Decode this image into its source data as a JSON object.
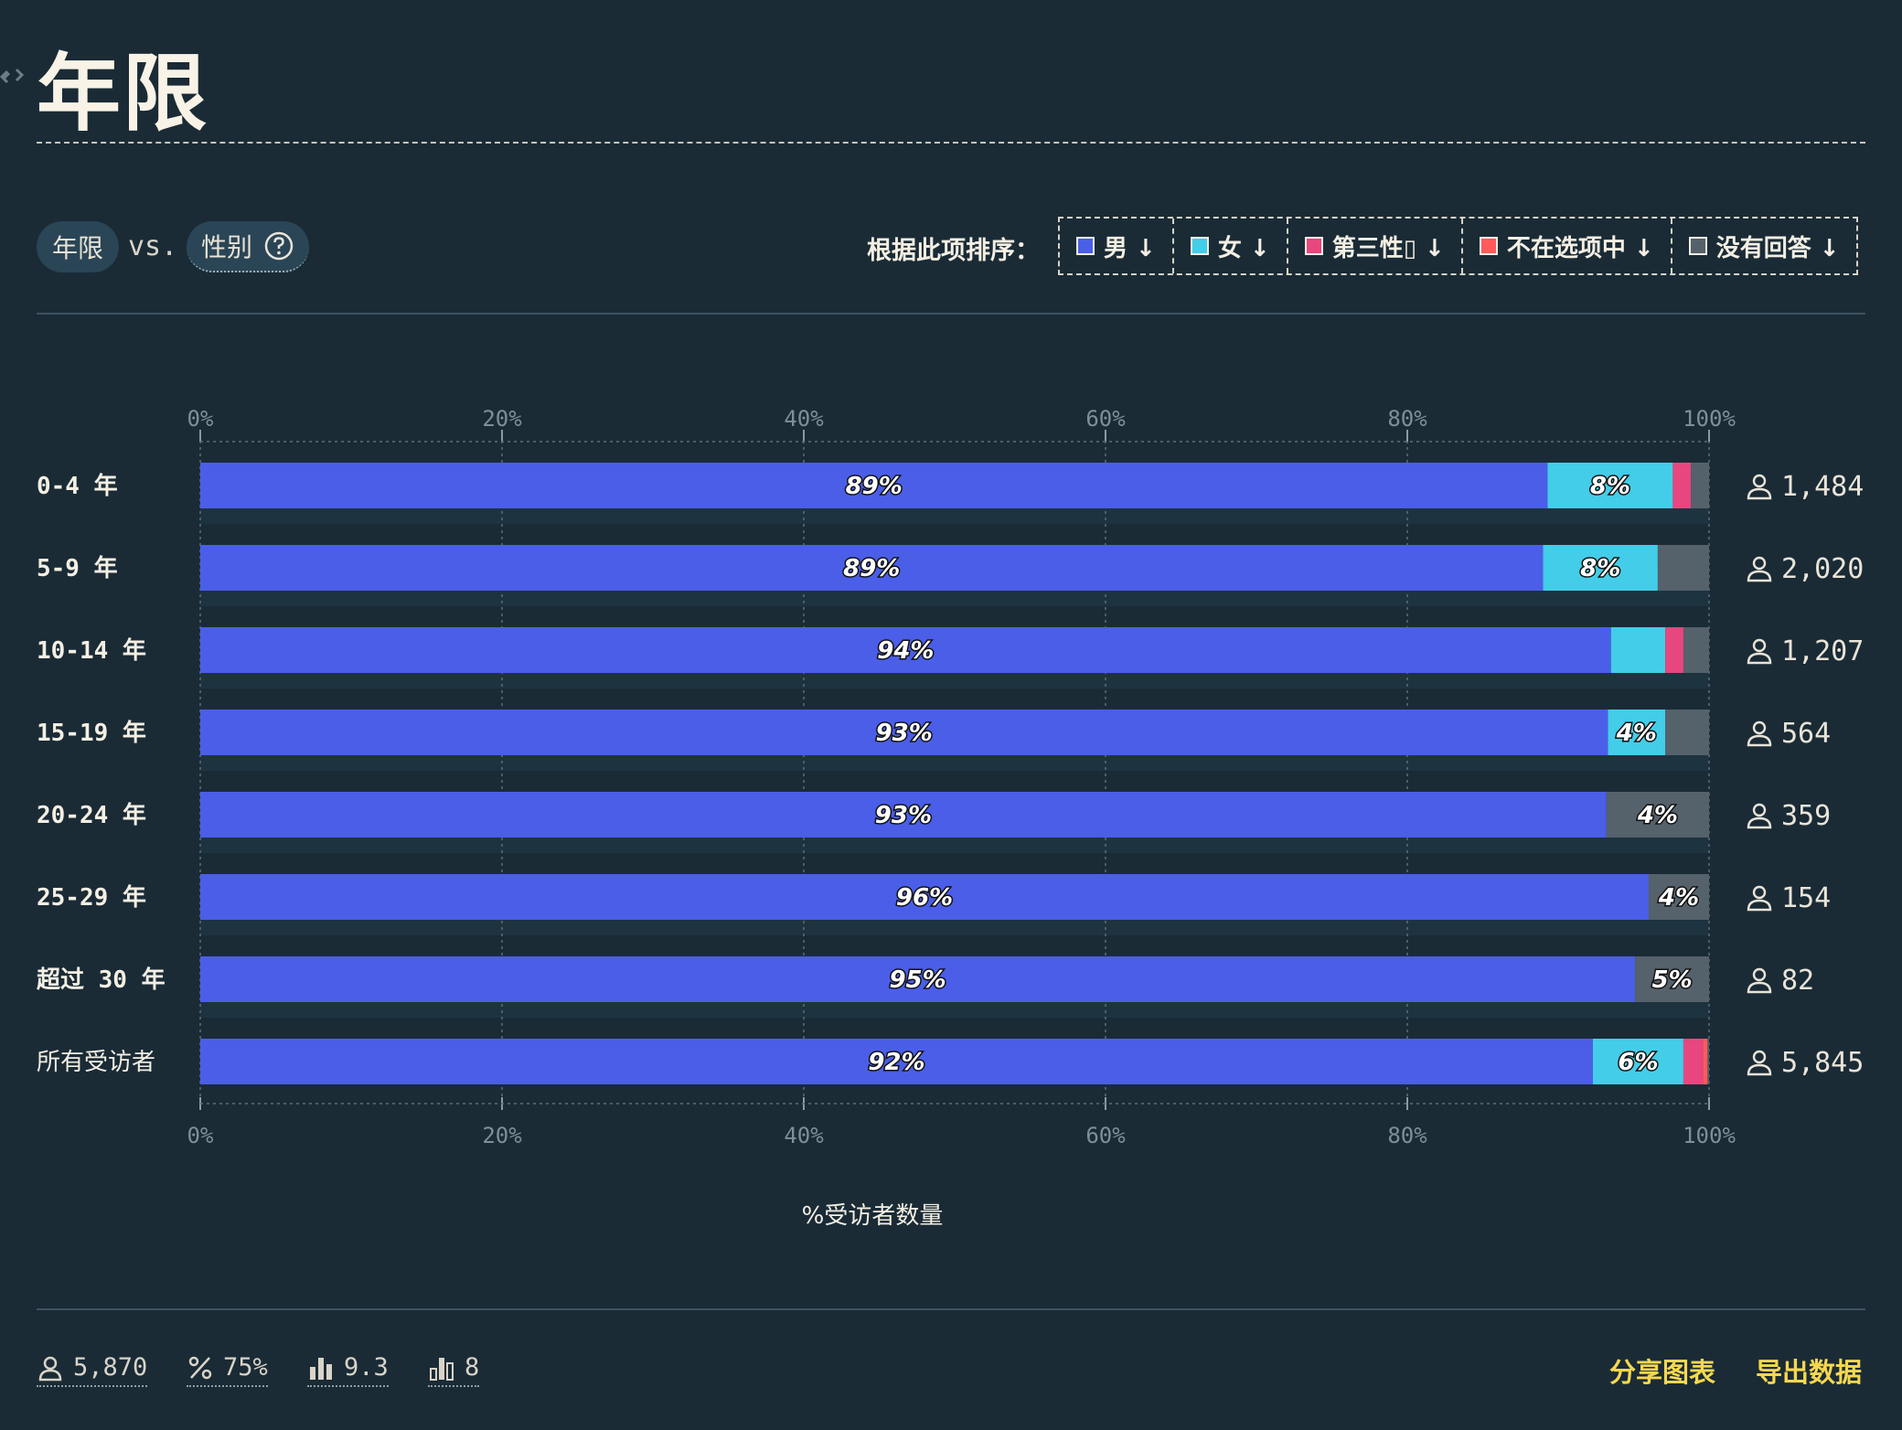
{
  "title": "年限",
  "compare": {
    "left": "年限",
    "vs": "vs.",
    "right": "性别"
  },
  "sort": {
    "label": "根据此项排序：",
    "buttons": [
      {
        "label": "男 ↓",
        "color": "#4a5ee8"
      },
      {
        "label": "女 ↓",
        "color": "#43cde8"
      },
      {
        "label": "第三性▯ ↓",
        "color": "#e8467f"
      },
      {
        "label": "不在选项中 ↓",
        "color": "#ff5a5a"
      },
      {
        "label": "没有回答 ↓",
        "color": "#55616b"
      }
    ]
  },
  "chart_data": {
    "type": "bar",
    "orientation": "horizontal-stacked-100",
    "xlabel": "%受访者数量",
    "xlim": [
      0,
      100
    ],
    "xticks": [
      "0%",
      "20%",
      "40%",
      "60%",
      "80%",
      "100%"
    ],
    "grid": true,
    "categories": [
      "0-4 年",
      "5-9 年",
      "10-14 年",
      "15-19 年",
      "20-24 年",
      "25-29 年",
      "超过 30 年",
      "所有受访者"
    ],
    "counts": [
      "1,484",
      "2,020",
      "1,207",
      "564",
      "359",
      "154",
      "82",
      "5,845"
    ],
    "series": [
      {
        "name": "男",
        "color": "#4a5ee8",
        "values": [
          89.3,
          89.0,
          93.5,
          93.3,
          93.2,
          96.0,
          95.1,
          92.3
        ],
        "labels": [
          "89%",
          "89%",
          "94%",
          "93%",
          "93%",
          "96%",
          "95%",
          "92%"
        ]
      },
      {
        "name": "女",
        "color": "#43cde8",
        "values": [
          8.3,
          7.6,
          3.6,
          3.8,
          0,
          0,
          0,
          6.0
        ],
        "labels": [
          "8%",
          "8%",
          "",
          "4%",
          "",
          "",
          "",
          "6%"
        ]
      },
      {
        "name": "第三性▯",
        "color": "#e8467f",
        "values": [
          1.2,
          0,
          1.2,
          0,
          0,
          0,
          0,
          1.3
        ],
        "labels": [
          "",
          "",
          "",
          "",
          "",
          "",
          "",
          ""
        ]
      },
      {
        "name": "不在选项中",
        "color": "#ff5a5a",
        "values": [
          0,
          0,
          0,
          0,
          0,
          0,
          0,
          0.3
        ],
        "labels": [
          "",
          "",
          "",
          "",
          "",
          "",
          "",
          ""
        ]
      },
      {
        "name": "没有回答",
        "color": "#55616b",
        "values": [
          1.2,
          3.4,
          1.7,
          2.9,
          6.8,
          4.0,
          4.9,
          0.1
        ],
        "labels": [
          "",
          "",
          "",
          "",
          "4%",
          "4%",
          "5%",
          ""
        ]
      }
    ]
  },
  "footer": {
    "respondents": "5,870",
    "percent": "75%",
    "score": "9.3",
    "bars": "8",
    "share": "分享图表",
    "export": "导出数据"
  }
}
